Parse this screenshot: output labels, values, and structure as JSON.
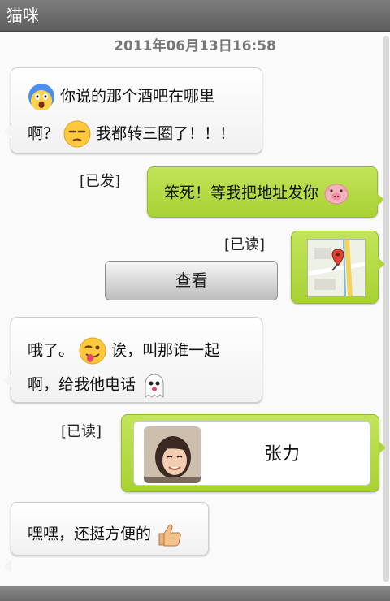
{
  "window": {
    "title": "猫咪"
  },
  "chat": {
    "timestamp": "2011年06月13日16:58",
    "msg1": {
      "line1": "你说的那个酒吧在哪里",
      "line2": "啊？",
      "line2b": "我都转三圈了！！！",
      "emoji1": "scream-face-icon",
      "emoji2": "unamused-face-icon"
    },
    "msg2": {
      "status": "[已发]",
      "text": "笨死！等我把地址发你",
      "emoji": "pig-face-icon"
    },
    "msg3": {
      "status": "[已读]",
      "view_label": "查看",
      "thumb": "map-pin-icon"
    },
    "msg4": {
      "line1a": "哦了。",
      "line1b": "诶，叫那谁一起",
      "line2": "啊，给我他电话",
      "emoji1": "winking-tongue-face-icon",
      "emoji2": "ghost-icon"
    },
    "msg5": {
      "status": "[已读]",
      "contact_name": "张力"
    },
    "msg6": {
      "text": "嘿嘿，还挺方便的",
      "emoji": "thumbs-up-icon"
    }
  },
  "colors": {
    "incoming": "#f3f3f3",
    "outgoing": "#b4dc41",
    "titlebar": "#6e6e6e"
  }
}
